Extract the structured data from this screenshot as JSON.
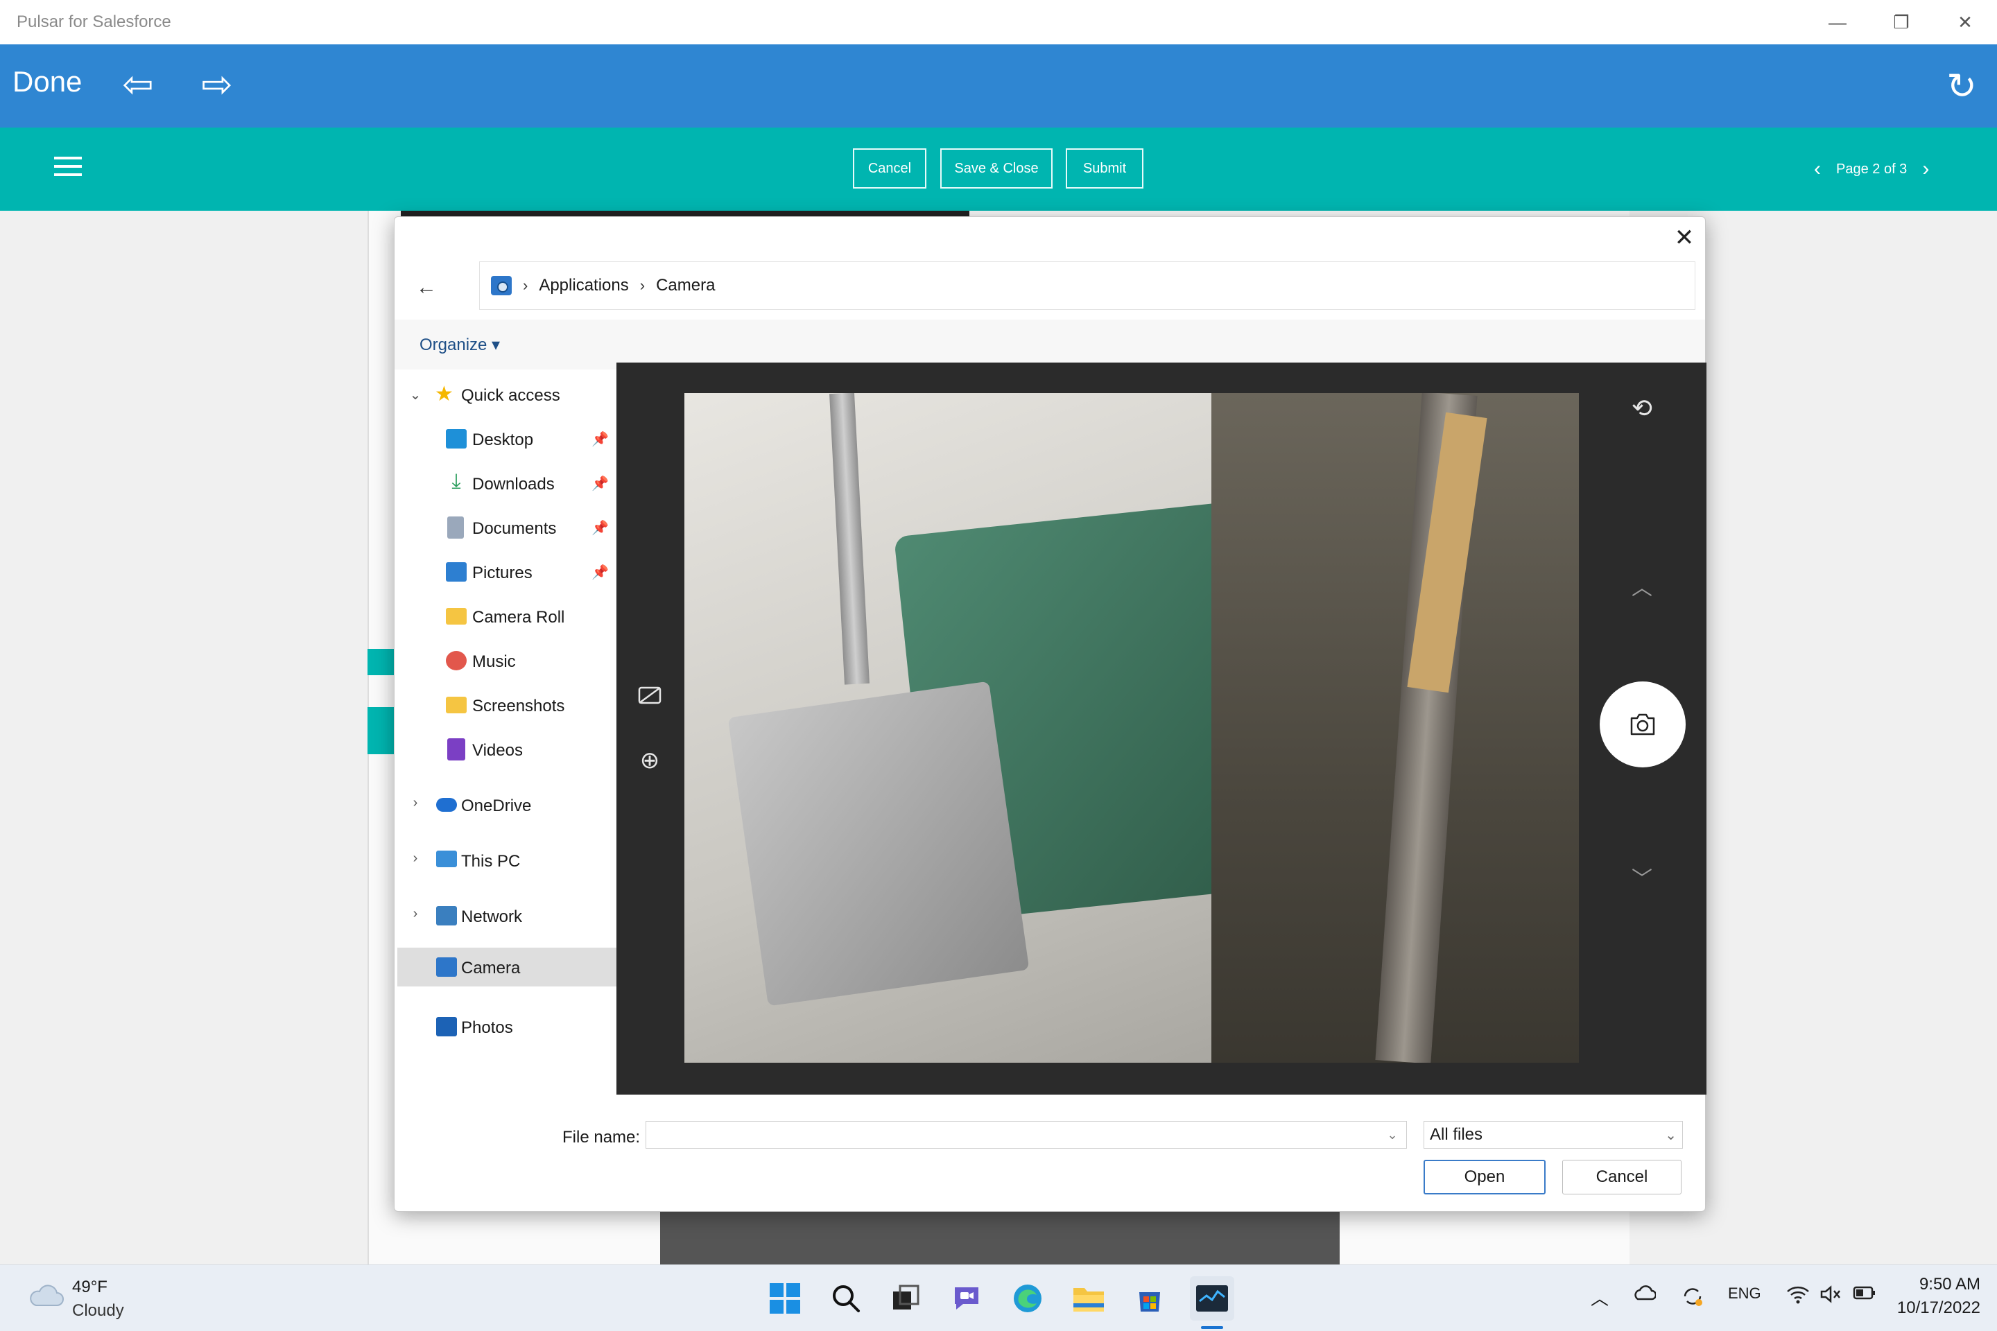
{
  "window": {
    "title": "Pulsar for Salesforce",
    "minimize_glyph": "—",
    "restore_glyph": "❐",
    "close_glyph": "✕"
  },
  "header": {
    "done_label": "Done",
    "back_glyph": "⇦",
    "forward_glyph": "⇨",
    "refresh_glyph": "↻"
  },
  "toolbar": {
    "cancel_label": "Cancel",
    "save_close_label": "Save & Close",
    "submit_label": "Submit",
    "page_label": "Page 2 of 3",
    "prev_glyph": "‹",
    "next_glyph": "›"
  },
  "dialog": {
    "close_glyph": "✕",
    "back_glyph": "←",
    "breadcrumb": [
      "Applications",
      "Camera"
    ],
    "crumb_sep": "›",
    "organize_label": "Organize ▾",
    "nav": {
      "quick_access": "Quick access",
      "items": [
        {
          "label": "Desktop",
          "pinned": true,
          "icon": "desktop-icon",
          "color": "#1e90d8"
        },
        {
          "label": "Downloads",
          "pinned": true,
          "icon": "downloads-icon",
          "color": "#2a9d5c"
        },
        {
          "label": "Documents",
          "pinned": true,
          "icon": "documents-icon",
          "color": "#7f8fa6"
        },
        {
          "label": "Pictures",
          "pinned": true,
          "icon": "pictures-icon",
          "color": "#2d7fd1"
        },
        {
          "label": "Camera Roll",
          "pinned": false,
          "icon": "folder-icon",
          "color": "#f5c542"
        },
        {
          "label": "Music",
          "pinned": false,
          "icon": "music-icon",
          "color": "#e2574c"
        },
        {
          "label": "Screenshots",
          "pinned": false,
          "icon": "folder-icon",
          "color": "#f5c542"
        },
        {
          "label": "Videos",
          "pinned": false,
          "icon": "videos-icon",
          "color": "#7b3fc4"
        }
      ],
      "onedrive": "OneDrive",
      "this_pc": "This PC",
      "network": "Network",
      "camera": "Camera",
      "photos": "Photos",
      "pin_glyph": "📌",
      "expanded_glyph": "⌄",
      "collapsed_glyph": "›"
    },
    "camera": {
      "switch_glyph": "⟲",
      "up_glyph": "︿",
      "down_glyph": "﹀",
      "zoom_glyph": "⊕"
    },
    "file_name_label": "File name:",
    "file_name_value": "",
    "file_type": "All files",
    "dropdown_glyph": "⌄",
    "open_label": "Open",
    "cancel_label": "Cancel"
  },
  "taskbar": {
    "weather_temp": "49°F",
    "weather_desc": "Cloudy",
    "tray_lang": "ENG",
    "tray_up_glyph": "︿",
    "time": "9:50 AM",
    "date": "10/17/2022"
  },
  "colors": {
    "title_blue": "#2f86d2",
    "teal": "#00b5b0"
  }
}
